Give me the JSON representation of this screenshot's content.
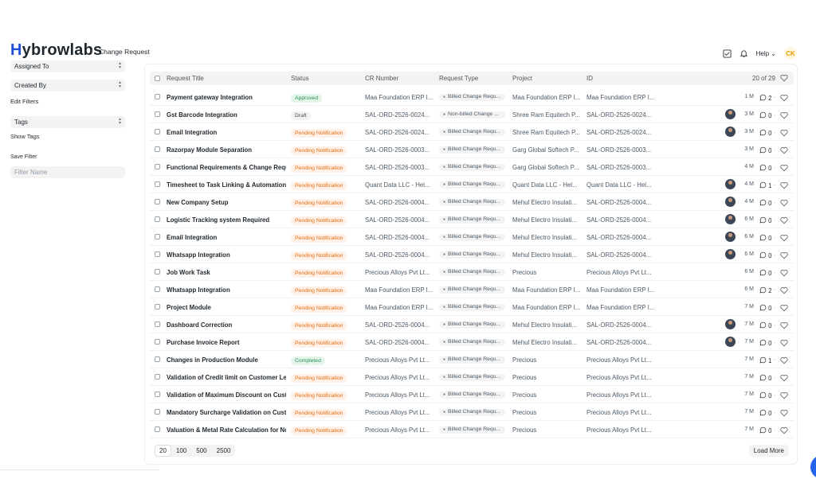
{
  "brand": {
    "logo_first": "H",
    "logo_rest": "ybrowlabs"
  },
  "breadcrumb": {
    "current": "Change Request"
  },
  "navbar": {
    "help_label": "Help",
    "user_initials": "CK"
  },
  "sidebar": {
    "assigned_to": "Assigned To",
    "created_by": "Created By",
    "edit_filters": "Edit Filters",
    "tags": "Tags",
    "show_tags": "Show Tags",
    "save_filter": "Save Filter",
    "filter_name_placeholder": "Filter Name"
  },
  "table": {
    "headers": {
      "title": "Request Title",
      "status": "Status",
      "cr": "CR Number",
      "type": "Request Type",
      "project": "Project",
      "id": "ID"
    },
    "count_label": "20 of 29",
    "rows": [
      {
        "title": "Payment gateway Integration",
        "status": "Approved",
        "status_kind": "approved",
        "cr": "Maa Foundation ERP I...",
        "type": "Billed Change Requ...",
        "project": "Maa Foundation ERP I...",
        "id": "Maa Foundation ERP I...",
        "avatar": false,
        "age": "1 M",
        "comments": "2"
      },
      {
        "title": "Gst Barcode Integration",
        "status": "Draft",
        "status_kind": "draft",
        "cr": "SAL-ORD-2526-0024...",
        "type": "Non-billed Change ...",
        "project": "Shree Ram Equitech P...",
        "id": "SAL-ORD-2526-0024...",
        "avatar": true,
        "age": "3 M",
        "comments": "0"
      },
      {
        "title": "Email Integration",
        "status": "Pending Notification",
        "status_kind": "pending",
        "cr": "SAL-ORD-2526-0024...",
        "type": "Billed Change Requ...",
        "project": "Shree Ram Equitech P...",
        "id": "SAL-ORD-2526-0024...",
        "avatar": true,
        "age": "3 M",
        "comments": "0"
      },
      {
        "title": "Razorpay Module Separation",
        "status": "Pending Notification",
        "status_kind": "pending",
        "cr": "SAL-ORD-2526-0003...",
        "type": "Billed Change Requ...",
        "project": "Garg Global Softech P...",
        "id": "SAL-ORD-2526-0003...",
        "avatar": false,
        "age": "3 M",
        "comments": "0"
      },
      {
        "title": "Functional Requirements & Change Requ",
        "status": "Pending Notification",
        "status_kind": "pending",
        "cr": "SAL-ORD-2526-0003...",
        "type": "Billed Change Requ...",
        "project": "Garg Global Softech P...",
        "id": "SAL-ORD-2526-0003...",
        "avatar": false,
        "age": "4 M",
        "comments": "0"
      },
      {
        "title": "Timesheet to Task Linking & Automation",
        "status": "Pending Notification",
        "status_kind": "pending",
        "cr": "Quant Data LLC - Hel...",
        "type": "Billed Change Requ...",
        "project": "Quant Data LLC - Hel...",
        "id": "Quant Data LLC - Hel...",
        "avatar": true,
        "age": "4 M",
        "comments": "1"
      },
      {
        "title": "New Company Setup",
        "status": "Pending Notification",
        "status_kind": "pending",
        "cr": "SAL-ORD-2526-0004...",
        "type": "Billed Change Requ...",
        "project": "Mehul Electro Insulati...",
        "id": "SAL-ORD-2526-0004...",
        "avatar": true,
        "age": "4 M",
        "comments": "0"
      },
      {
        "title": "Logistic Tracking system Required",
        "status": "Pending Notification",
        "status_kind": "pending",
        "cr": "SAL-ORD-2526-0004...",
        "type": "Billed Change Requ...",
        "project": "Mehul Electro Insulati...",
        "id": "SAL-ORD-2526-0004...",
        "avatar": true,
        "age": "6 M",
        "comments": "0"
      },
      {
        "title": "Email Integration",
        "status": "Pending Notification",
        "status_kind": "pending",
        "cr": "SAL-ORD-2526-0004...",
        "type": "Billed Change Requ...",
        "project": "Mehul Electro Insulati...",
        "id": "SAL-ORD-2526-0004...",
        "avatar": true,
        "age": "6 M",
        "comments": "0"
      },
      {
        "title": "Whatsapp Integration",
        "status": "Pending Notification",
        "status_kind": "pending",
        "cr": "SAL-ORD-2526-0004...",
        "type": "Billed Change Requ...",
        "project": "Mehul Electro Insulati...",
        "id": "SAL-ORD-2526-0004...",
        "avatar": true,
        "age": "6 M",
        "comments": "0"
      },
      {
        "title": "Job Work Task",
        "status": "Pending Notification",
        "status_kind": "pending",
        "cr": "Precious Alloys Pvt Lt...",
        "type": "Billed Change Requ...",
        "project": "Precious",
        "id": "Precious Alloys Pvt Lt...",
        "avatar": false,
        "age": "6 M",
        "comments": "0"
      },
      {
        "title": "Whatsapp Integration",
        "status": "Pending Notification",
        "status_kind": "pending",
        "cr": "Maa Foundation ERP I...",
        "type": "Billed Change Requ...",
        "project": "Maa Foundation ERP I...",
        "id": "Maa Foundation ERP I...",
        "avatar": false,
        "age": "6 M",
        "comments": "2"
      },
      {
        "title": "Project Module",
        "status": "Pending Notification",
        "status_kind": "pending",
        "cr": "Maa Foundation ERP I...",
        "type": "Billed Change Requ...",
        "project": "Maa Foundation ERP I...",
        "id": "Maa Foundation ERP I...",
        "avatar": false,
        "age": "7 M",
        "comments": "0"
      },
      {
        "title": "Dashboard Correction",
        "status": "Pending Notification",
        "status_kind": "pending",
        "cr": "SAL-ORD-2526-0004...",
        "type": "Billed Change Requ...",
        "project": "Mehul Electro Insulati...",
        "id": "SAL-ORD-2526-0004...",
        "avatar": true,
        "age": "7 M",
        "comments": "0"
      },
      {
        "title": "Purchase Invoice Report",
        "status": "Pending Notification",
        "status_kind": "pending",
        "cr": "SAL-ORD-2526-0004...",
        "type": "Billed Change Requ...",
        "project": "Mehul Electro Insulati...",
        "id": "SAL-ORD-2526-0004...",
        "avatar": true,
        "age": "7 M",
        "comments": "0"
      },
      {
        "title": "Changes in Production Module",
        "status": "Completed",
        "status_kind": "completed",
        "cr": "Precious Alloys Pvt Lt...",
        "type": "Billed Change Requ...",
        "project": "Precious",
        "id": "Precious Alloys Pvt Lt...",
        "avatar": false,
        "age": "7 M",
        "comments": "1"
      },
      {
        "title": "Validation of Credit limit on Customer Le",
        "status": "Pending Notification",
        "status_kind": "pending",
        "cr": "Precious Alloys Pvt Lt...",
        "type": "Billed Change Requ...",
        "project": "Precious",
        "id": "Precious Alloys Pvt Lt...",
        "avatar": false,
        "age": "7 M",
        "comments": "0"
      },
      {
        "title": "Validation of Maximum Discount on Cust",
        "status": "Pending Notification",
        "status_kind": "pending",
        "cr": "Precious Alloys Pvt Lt...",
        "type": "Billed Change Requ...",
        "project": "Precious",
        "id": "Precious Alloys Pvt Lt...",
        "avatar": false,
        "age": "7 M",
        "comments": "0"
      },
      {
        "title": "Mandatory Surcharge Validation on Cust",
        "status": "Pending Notification",
        "status_kind": "pending",
        "cr": "Precious Alloys Pvt Lt...",
        "type": "Billed Change Requ...",
        "project": "Precious",
        "id": "Precious Alloys Pvt Lt...",
        "avatar": false,
        "age": "7 M",
        "comments": "0"
      },
      {
        "title": "Valuation & Metal Rate Calculation for No",
        "status": "Pending Notification",
        "status_kind": "pending",
        "cr": "Precious Alloys Pvt Lt...",
        "type": "Billed Change Requ...",
        "project": "Precious",
        "id": "Precious Alloys Pvt Lt...",
        "avatar": false,
        "age": "7 M",
        "comments": "0"
      }
    ]
  },
  "paging": {
    "sizes": [
      "20",
      "100",
      "500",
      "2500"
    ],
    "load_more": "Load More"
  }
}
